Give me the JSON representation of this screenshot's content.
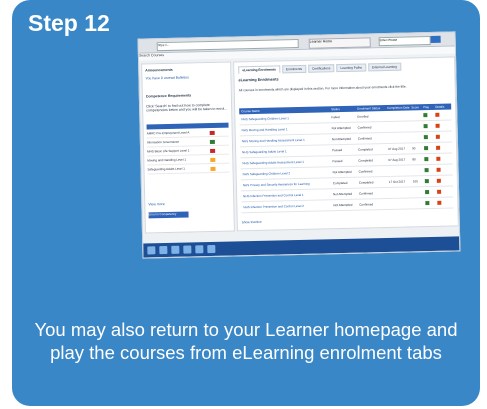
{
  "title": "Step 12",
  "caption": "You may also return to your Learner homepage and play the courses from eLearning enrolment tabs",
  "screenshot": {
    "url": "https://...",
    "tab_title": "Learner Home",
    "search_placeholder": "Enter Phrase",
    "nav_left": "Search   Courses",
    "left_panel": {
      "announcements": "Announcements",
      "announcement_link": "You have 0 unread Bulletins",
      "competency_header": "Competence Requirements",
      "competency_intro": "Click 'Search' to find out how to complete competencies below and you will be taken to enrol...",
      "competency_rows": [
        {
          "name": "AMRC Pre-Employment Level A",
          "color": "#c62828"
        },
        {
          "name": "Information Governance",
          "color": "#2e7d32"
        },
        {
          "name": "MHS Basic Life Support Level 1",
          "color": "#c62828"
        },
        {
          "name": "Moving and Handling Level 1",
          "color": "#f9a825"
        },
        {
          "name": "Safeguarding Adults Level 1",
          "color": "#f9a825"
        }
      ],
      "more_link": "View more",
      "button": "Enrol in Competency"
    },
    "tabs": [
      "eLearning Enrolments",
      "Enrolments",
      "Certifications",
      "Learning Paths",
      "External Learning"
    ],
    "section_title": "eLearning Enrolments",
    "section_text": "All courses in enrolments which are displayed in this section. For more information about your enrolments click the title.",
    "table_headers": [
      "Course Name",
      "Status",
      "Enrolment Status",
      "Completion Date",
      "Score",
      "Play",
      "Details"
    ],
    "rows": [
      {
        "name": "NHS Safeguarding Children Level 1",
        "status": "Failed",
        "enrol": "Enrolled",
        "date": "",
        "score": ""
      },
      {
        "name": "NHS Moving and Handling Level 1",
        "status": "Not Attempted",
        "enrol": "Confirmed",
        "date": "",
        "score": ""
      },
      {
        "name": "NHS Moving and Handling Assessment Level 1",
        "status": "Not Attempted",
        "enrol": "Confirmed",
        "date": "",
        "score": ""
      },
      {
        "name": "NHS Safeguarding Adults Level 1",
        "status": "Passed",
        "enrol": "Completed",
        "date": "07 Aug 2017",
        "score": "90"
      },
      {
        "name": "NHS Safeguarding Adults Assessment Level 1",
        "status": "Passed",
        "enrol": "Completed",
        "date": "07 Aug 2017",
        "score": "80"
      },
      {
        "name": "NHS Safeguarding Children Level 2",
        "status": "Not Attempted",
        "enrol": "Confirmed",
        "date": "",
        "score": ""
      },
      {
        "name": "NHS Privacy and Security Awareness for Learning",
        "status": "Completed",
        "enrol": "Completed",
        "date": "17 Oct 2017",
        "score": "100"
      },
      {
        "name": "NHS Infection Prevention and Control Level 1",
        "status": "Not Attempted",
        "enrol": "Confirmed",
        "date": "",
        "score": ""
      },
      {
        "name": "NHS Infection Prevention and Control Level 2",
        "status": "Not Attempted",
        "enrol": "Confirmed",
        "date": "",
        "score": ""
      }
    ],
    "show_inactive": "Show Inactive"
  },
  "colors": {
    "card": "#3a87c8",
    "table_header": "#2e63b8",
    "taskbar": "#1c4f95"
  }
}
